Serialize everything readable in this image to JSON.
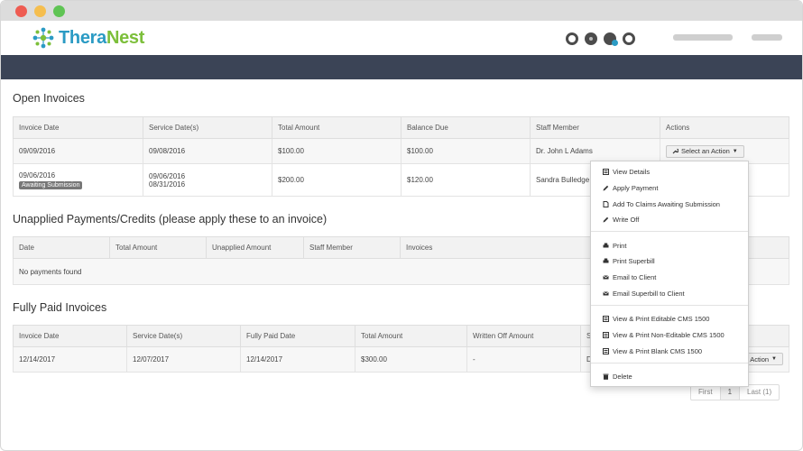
{
  "header": {
    "logo_part1": "Thera",
    "logo_part2": "Nest"
  },
  "open_invoices": {
    "title": "Open Invoices",
    "columns": [
      "Invoice Date",
      "Service Date(s)",
      "Total Amount",
      "Balance Due",
      "Staff Member",
      "Actions"
    ],
    "rows": [
      {
        "invoice_date": "09/09/2016",
        "service_date": "09/08/2016",
        "service_date2": "",
        "total": "$100.00",
        "balance": "$100.00",
        "staff": "Dr. John L Adams",
        "tag": ""
      },
      {
        "invoice_date": "09/06/2016",
        "service_date": "09/06/2016",
        "service_date2": "08/31/2016",
        "total": "$200.00",
        "balance": "$120.00",
        "staff": "Sandra Bulledge",
        "tag": "Awaiting Submission"
      }
    ],
    "action_label": "Select an Action"
  },
  "unapplied": {
    "title": "Unapplied Payments/Credits (please apply these to an invoice)",
    "columns": [
      "Date",
      "Total Amount",
      "Unapplied Amount",
      "Staff Member",
      "Invoices"
    ],
    "empty_text": "No payments found"
  },
  "fully_paid": {
    "title": "Fully Paid Invoices",
    "columns": [
      "Invoice Date",
      "Service Date(s)",
      "Fully Paid Date",
      "Total Amount",
      "Written Off Amount",
      "St"
    ],
    "row": {
      "invoice_date": "12/14/2017",
      "service_date": "12/07/2017",
      "paid_date": "12/14/2017",
      "total": "$300.00",
      "written_off": "-",
      "staff": "D"
    },
    "action_label": "Action"
  },
  "dropdown": {
    "items": [
      {
        "label": "View Details",
        "icon": "list-icon"
      },
      {
        "label": "Apply Payment",
        "icon": "pencil-icon"
      },
      {
        "label": "Add To Claims Awaiting Submission",
        "icon": "document-icon"
      },
      {
        "label": "Write Off",
        "icon": "pencil-icon"
      },
      {
        "label": "Print",
        "icon": "printer-icon"
      },
      {
        "label": "Print Superbill",
        "icon": "printer-icon"
      },
      {
        "label": "Email to Client",
        "icon": "envelope-icon"
      },
      {
        "label": "Email Superbill to Client",
        "icon": "envelope-icon"
      },
      {
        "label": "View & Print Editable CMS 1500",
        "icon": "list-icon"
      },
      {
        "label": "View & Print Non-Editable CMS 1500",
        "icon": "list-icon"
      },
      {
        "label": "View & Print Blank CMS 1500",
        "icon": "list-icon"
      },
      {
        "label": "Delete",
        "icon": "trash-icon"
      }
    ]
  },
  "pager": {
    "first": "First",
    "current": "1",
    "last": "Last (1)"
  },
  "colors": {
    "brand_blue": "#2b9bc4",
    "brand_green": "#7cbf3a",
    "navbar": "#3b4456"
  }
}
